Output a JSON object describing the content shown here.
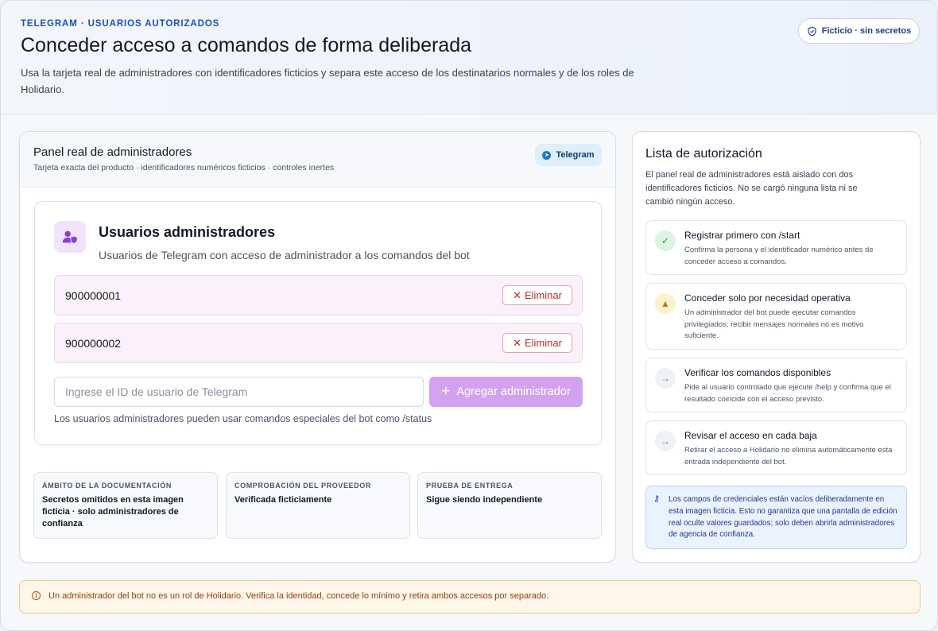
{
  "header": {
    "eyebrow": "TELEGRAM · USUARIOS AUTORIZADOS",
    "title": "Conceder acceso a comandos de forma deliberada",
    "subtitle": "Usa la tarjeta real de administradores con identificadores ficticios y separa este acceso de los destinatarios normales y de los roles de Holidario.",
    "badge": "Ficticio · sin secretos",
    "badge_icon": "shield-icon"
  },
  "left_card": {
    "title": "Panel real de administradores",
    "subtitle": "Tarjeta exacta del producto · identificadores numéricos ficticios · controles inertes",
    "tag": "Telegram",
    "tag_icon": "telegram-icon",
    "panel": {
      "icon": "user-shield-icon",
      "title": "Usuarios administradores",
      "subtitle": "Usuarios de Telegram con acceso de administrador a los comandos del bot",
      "admins": [
        {
          "id": "900000001",
          "remove_label": "Eliminar"
        },
        {
          "id": "900000002",
          "remove_label": "Eliminar"
        }
      ],
      "input_placeholder": "Ingrese el ID de usuario de Telegram",
      "input_value": "",
      "add_label": "Agregar administrador",
      "hint": "Los usuarios administradores pueden usar comandos especiales del bot como /status"
    },
    "stats": [
      {
        "label": "ÁMBITO DE LA DOCUMENTACIÓN",
        "value": "Secretos omitidos en esta imagen ficticia · solo administradores de confianza"
      },
      {
        "label": "COMPROBACIÓN DEL PROVEEDOR",
        "value": "Verificada ficticiamente"
      },
      {
        "label": "PRUEBA DE ENTREGA",
        "value": "Sigue siendo independiente"
      }
    ]
  },
  "right_card": {
    "title": "Lista de autorización",
    "subtitle": "El panel real de administradores está aislado con dos identificadores ficticios. No se cargó ninguna lista ni se cambió ningún acceso.",
    "steps": [
      {
        "icon": "check-icon",
        "title": "Registrar primero con /start",
        "desc": "Confirma la persona y el identificador numérico antes de conceder acceso a comandos."
      },
      {
        "icon": "warning-icon",
        "title": "Conceder solo por necesidad operativa",
        "desc": "Un administrador del bot puede ejecutar comandos privilegiados; recibir mensajes normales no es motivo suficiente."
      },
      {
        "icon": "arrow-right-icon",
        "title": "Verificar los comandos disponibles",
        "desc": "Pide al usuario controlado que ejecute /help y confirma que el resultado coincide con el acceso previsto."
      },
      {
        "icon": "arrow-right-icon",
        "title": "Revisar el acceso en cada baja",
        "desc": "Retirar el acceso a Holidario no elimina automáticamente esta entrada independiente del bot."
      }
    ],
    "note": "Los campos de credenciales están vacíos deliberadamente en esta imagen ficticia. Esto no garantiza que una pantalla de edición real oculte valores guardados; solo deben abrirla administradores de agencia de confianza.",
    "note_icon": "key-icon"
  },
  "alert": {
    "icon": "info-icon",
    "text": "Un administrador del bot no es un rol de Holidario. Verifica la identidad, concede lo mínimo y retira ambos accesos por separado."
  },
  "colors": {
    "brand": "#1d4fb8",
    "accent": "#d3a2ef",
    "danger": "#c62828",
    "success": "#1f9d4d",
    "warning": "#b7791f"
  }
}
